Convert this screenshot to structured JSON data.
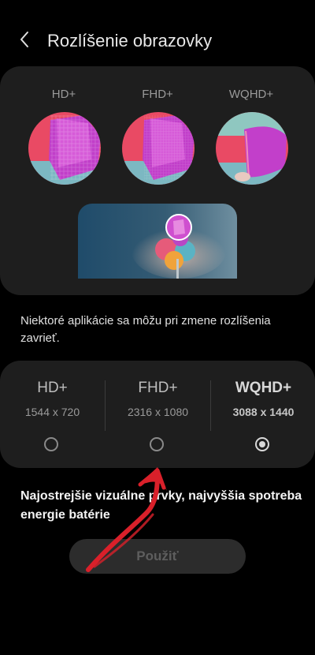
{
  "header": {
    "title": "Rozlíšenie obrazovky",
    "back_icon": "chevron-left-icon"
  },
  "preview": {
    "labels": [
      "HD+",
      "FHD+",
      "WQHD+"
    ]
  },
  "notice": "Niektoré aplikácie sa môžu pri zmene rozlíšenia zavrieť.",
  "options": [
    {
      "name": "HD+",
      "size": "1544 x 720",
      "selected": false
    },
    {
      "name": "FHD+",
      "size": "2316 x 1080",
      "selected": false
    },
    {
      "name": "WQHD+",
      "size": "3088 x 1440",
      "selected": true
    }
  ],
  "description": "Najostrejšie vizuálne prvky, najvyššia spotreba energie batérie",
  "apply_label": "Použiť",
  "colors": {
    "background": "#000000",
    "card": "#1e1e1e",
    "annotation_arrow": "#d9202a"
  }
}
